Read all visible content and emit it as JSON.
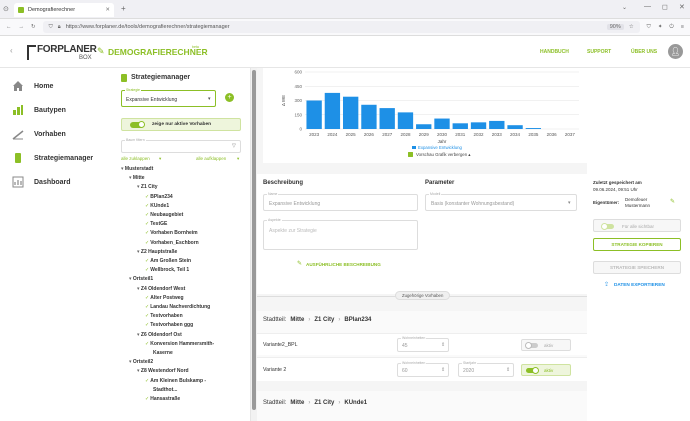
{
  "browser": {
    "tab_title": "Demografierechner",
    "url": "https://www.forplaner.de/tools/demografierechner/strategiemanager",
    "zoom": "90%"
  },
  "header": {
    "logo_main": "FORPLANER",
    "logo_sub": "BOX",
    "app_name": "DEMOGRAFIERECHNER",
    "app_sup": "beta",
    "links": [
      "HANDBUCH",
      "SUPPORT",
      "ÜBER UNS"
    ]
  },
  "sidenav": [
    {
      "label": "Home",
      "icon": "home-icon"
    },
    {
      "label": "Bautypen",
      "icon": "bautypen-icon"
    },
    {
      "label": "Vorhaben",
      "icon": "vorhaben-icon"
    },
    {
      "label": "Strategiemanager",
      "icon": "strategiemanager-icon"
    },
    {
      "label": "Dashboard",
      "icon": "dashboard-icon"
    }
  ],
  "tree": {
    "title": "Strategiemanager",
    "strategy_label": "Strategie",
    "strategy_value": "Expansive Entwicklung",
    "toggle_label": "zeige nur aktive Vorhaben",
    "search_label": "Baum filtern",
    "collapse_all": "alle zuklappen",
    "expand_all": "alle aufklappen",
    "nodes": [
      {
        "text": "Musterstadt",
        "level": 0,
        "arrow": true,
        "check": false
      },
      {
        "text": "Mitte",
        "level": 1,
        "arrow": true,
        "check": false
      },
      {
        "text": "Z1 City",
        "level": 2,
        "arrow": true,
        "check": false
      },
      {
        "text": "BPlan234",
        "level": 3,
        "arrow": false,
        "check": true
      },
      {
        "text": "KUnde1",
        "level": 3,
        "arrow": false,
        "check": true
      },
      {
        "text": "Neubaugebiet",
        "level": 3,
        "arrow": false,
        "check": true
      },
      {
        "text": "TestGE",
        "level": 3,
        "arrow": false,
        "check": true
      },
      {
        "text": "Vorhaben Bornheim",
        "level": 3,
        "arrow": false,
        "check": true
      },
      {
        "text": "Vorhaben_Eschborn",
        "level": 3,
        "arrow": false,
        "check": true
      },
      {
        "text": "Z2 Hauptstraße",
        "level": 2,
        "arrow": true,
        "check": false
      },
      {
        "text": "Am Großen Stein",
        "level": 3,
        "arrow": false,
        "check": true
      },
      {
        "text": "Wellbrock, Teil 1",
        "level": 3,
        "arrow": false,
        "check": true
      },
      {
        "text": "Ortsteil1",
        "level": 1,
        "arrow": true,
        "check": false
      },
      {
        "text": "Z4 Oldendorf West",
        "level": 2,
        "arrow": true,
        "check": false
      },
      {
        "text": "Alter Postweg",
        "level": 3,
        "arrow": false,
        "check": true
      },
      {
        "text": "Landau Nachverdichtung",
        "level": 3,
        "arrow": false,
        "check": true
      },
      {
        "text": "Testvorhaben",
        "level": 3,
        "arrow": false,
        "check": true
      },
      {
        "text": "Testvorhaben ggg",
        "level": 3,
        "arrow": false,
        "check": true
      },
      {
        "text": "Z6 Oldendorf Ost",
        "level": 2,
        "arrow": true,
        "check": false
      },
      {
        "text": "Konversion Hammersmith-",
        "level": 3,
        "arrow": false,
        "check": true
      },
      {
        "text": "Kaserne",
        "level": 4,
        "arrow": false,
        "check": false
      },
      {
        "text": "Ortsteil2",
        "level": 1,
        "arrow": true,
        "check": false
      },
      {
        "text": "Z8 Westendorf Nord",
        "level": 2,
        "arrow": true,
        "check": false
      },
      {
        "text": "Am Kleinen Bulskamp -",
        "level": 3,
        "arrow": false,
        "check": true
      },
      {
        "text": "Stadthot...",
        "level": 4,
        "arrow": false,
        "check": false
      },
      {
        "text": "Hansastraße",
        "level": 3,
        "arrow": false,
        "check": true
      }
    ]
  },
  "chart_data": {
    "type": "bar",
    "categories": [
      "2023",
      "2024",
      "2025",
      "2026",
      "2027",
      "2028",
      "2029",
      "2030",
      "2031",
      "2032",
      "2033",
      "2034",
      "2035",
      "2036",
      "2037"
    ],
    "values": [
      300,
      380,
      340,
      255,
      220,
      175,
      50,
      110,
      60,
      70,
      85,
      40,
      10,
      0,
      0
    ],
    "ylabel": "Δ WE",
    "xlabel": "Jahr",
    "yticks": [
      0,
      150,
      300,
      450,
      600
    ],
    "ylim": [
      0,
      600
    ],
    "legend": "Expansive Entwicklung",
    "color": "#1e90e6",
    "grid": true
  },
  "chart_toggle_label": "Vorschau Grafik verbergen",
  "form": {
    "desc_heading": "Beschreibung",
    "param_heading": "Parameter",
    "name_label": "Name",
    "name_value": "Expansive Entwicklung",
    "aspekt_label": "Aspekte",
    "aspekt_placeholder": "Aspekte zur Strategie",
    "param_label": "Modell",
    "param_value": "Basis (konstanter Wohnungsbestand)",
    "detail_btn": "AUSFÜHRLICHE BESCHREIBUNG"
  },
  "divider_label": "Zugehörige Vorhaben",
  "sections": [
    {
      "crumb": [
        "Stadtteil:",
        "Mitte",
        "Z1 City",
        "BPlan234"
      ],
      "rows": [
        {
          "name": "Variante2_BPL",
          "we_label": "Wohneinheiten",
          "we": "45",
          "year_label": "",
          "year": "",
          "active": "aktiv",
          "on": false
        },
        {
          "name": "Variante 2",
          "we_label": "Wohneinheiten",
          "we": "60",
          "year_label": "Startjahr",
          "year": "2020",
          "active": "aktiv",
          "on": true
        }
      ]
    },
    {
      "crumb": [
        "Stadtteil:",
        "Mitte",
        "Z1 City",
        "KUnde1"
      ],
      "rows": []
    }
  ],
  "right": {
    "saved_label": "Zuletzt gespeichert am",
    "saved_value": "09.06.2024, 09:51 Uhr",
    "owner_label": "Eigentümer:",
    "owner_value": "Demofeuer Mustermann",
    "toggle_all": "Für alle sichtbar",
    "copy_btn": "STRATEGIE KOPIEREN",
    "save_btn": "STRATEGIE SPEICHERN",
    "export_btn": "DATEN EXPORTIEREN"
  },
  "colors": {
    "accent": "#8cbf26",
    "bar": "#1e90e6",
    "header_text": "#8cbf26"
  }
}
